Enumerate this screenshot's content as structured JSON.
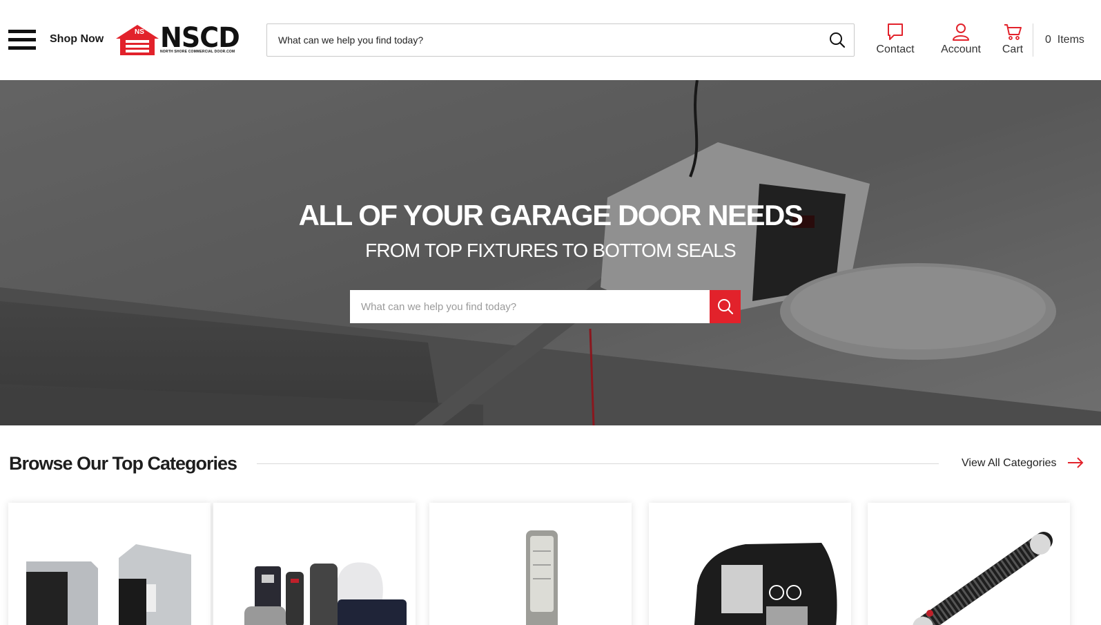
{
  "header": {
    "menu_icon": "hamburger-menu-icon",
    "shop_now_label": "Shop Now",
    "logo": {
      "badge": "NS",
      "wordmark": "NSCD",
      "tagline": "NORTH SHORE COMMERCIAL DOOR.COM"
    },
    "search": {
      "placeholder": "What can we help you find today?",
      "icon": "search-icon"
    },
    "nav": {
      "contact_label": "Contact",
      "account_label": "Account",
      "cart_label": "Cart",
      "items_label": "0  Items"
    }
  },
  "hero": {
    "title": "ALL OF YOUR GARAGE DOOR NEEDS",
    "subtitle": "FROM TOP FIXTURES TO BOTTOM SEALS",
    "search_placeholder": "What can we help you find today?",
    "search_icon": "search-icon"
  },
  "categories": {
    "heading": "Browse Our Top Categories",
    "view_all_label": "View All Categories",
    "view_all_icon": "arrow-right-icon",
    "cards": [
      {
        "image": "weather-seal-brush-product"
      },
      {
        "image": "remote-controls-product"
      },
      {
        "image": "keypad-product"
      },
      {
        "image": "opener-logic-board-product"
      },
      {
        "image": "torsion-spring-product"
      }
    ]
  },
  "colors": {
    "accent": "#e2222b",
    "text": "#1e1e1e"
  }
}
